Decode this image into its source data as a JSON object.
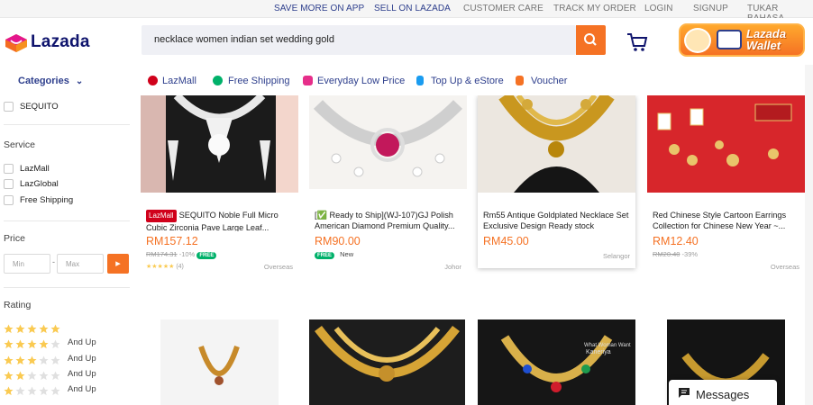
{
  "topbar": {
    "links": [
      "SAVE MORE ON APP",
      "SELL ON LAZADA",
      "CUSTOMER CARE",
      "TRACK MY ORDER",
      "LOGIN",
      "SIGNUP",
      "TUKAR BAHASA"
    ]
  },
  "header": {
    "logo_text": "Lazada",
    "search_value": "necklace women indian set wedding gold",
    "wallet_label_1": "Lazada",
    "wallet_label_2": "Wallet"
  },
  "nav": {
    "items": [
      {
        "label": "LazMall",
        "icon": "lazmall-icon",
        "color": "#d0011b"
      },
      {
        "label": "Free Shipping",
        "icon": "free-shipping-icon",
        "color": "#00b16a"
      },
      {
        "label": "Everyday Low Price",
        "icon": "heart-icon",
        "color": "#e62e8a"
      },
      {
        "label": "Top Up & eStore",
        "icon": "phone-icon",
        "color": "#1a9cf0"
      },
      {
        "label": "Voucher",
        "icon": "voucher-icon",
        "color": "#f57224"
      }
    ]
  },
  "sidebar": {
    "categories_title": "Categories",
    "brand_option": "SEQUITO",
    "service_title": "Service",
    "service_options": [
      "LazMall",
      "LazGlobal",
      "Free Shipping"
    ],
    "price_title": "Price",
    "price_min_placeholder": "Min",
    "price_max_placeholder": "Max",
    "price_separator": "-",
    "rating_title": "Rating",
    "and_up": "And Up"
  },
  "products": [
    {
      "title": "SEQUITO Noble Full Micro Cubic Zirconia Pave Large Leaf...",
      "price": "RM157.12",
      "old_price": "RM174.31",
      "discount": "-10%",
      "free_tag": "FREE",
      "reviews": "(4)",
      "location": "Overseas",
      "badge": "LazMall"
    },
    {
      "title": "[✅ Ready to Ship](WJ-107)GJ Polish American Diamond Premium Quality...",
      "price": "RM90.00",
      "free_tag": "FREE",
      "new_tag": "New",
      "location": "Johor"
    },
    {
      "title": "Rm55 Antique Goldplated Necklace Set Exclusive Design Ready stock",
      "price": "RM45.00",
      "location": "Selangor"
    },
    {
      "title": "Red Chinese Style Cartoon Earrings Collection for Chinese New Year ~...",
      "price": "RM12.40",
      "old_price": "RM20.40",
      "discount": "-39%",
      "location": "Overseas"
    }
  ],
  "row2_watermark": "What Woman Want\nKaneriya",
  "messages": {
    "label": "Messages"
  },
  "colors": {
    "accent": "#f57224",
    "brand": "#0f146d",
    "link": "#2d3e8c",
    "star": "#faca51"
  }
}
